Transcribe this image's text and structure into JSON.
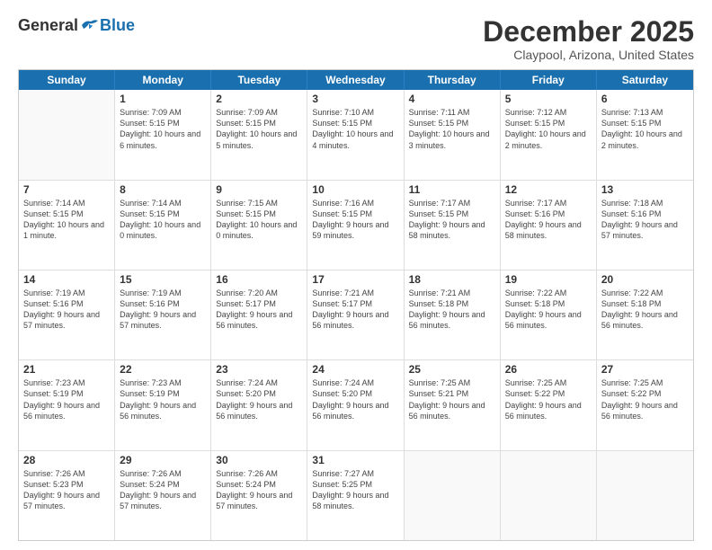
{
  "logo": {
    "general": "General",
    "blue": "Blue"
  },
  "title": "December 2025",
  "location": "Claypool, Arizona, United States",
  "weekdays": [
    "Sunday",
    "Monday",
    "Tuesday",
    "Wednesday",
    "Thursday",
    "Friday",
    "Saturday"
  ],
  "weeks": [
    [
      {
        "day": "",
        "empty": true
      },
      {
        "day": "1",
        "sunrise": "7:09 AM",
        "sunset": "5:15 PM",
        "daylight": "10 hours and 6 minutes."
      },
      {
        "day": "2",
        "sunrise": "7:09 AM",
        "sunset": "5:15 PM",
        "daylight": "10 hours and 5 minutes."
      },
      {
        "day": "3",
        "sunrise": "7:10 AM",
        "sunset": "5:15 PM",
        "daylight": "10 hours and 4 minutes."
      },
      {
        "day": "4",
        "sunrise": "7:11 AM",
        "sunset": "5:15 PM",
        "daylight": "10 hours and 3 minutes."
      },
      {
        "day": "5",
        "sunrise": "7:12 AM",
        "sunset": "5:15 PM",
        "daylight": "10 hours and 2 minutes."
      },
      {
        "day": "6",
        "sunrise": "7:13 AM",
        "sunset": "5:15 PM",
        "daylight": "10 hours and 2 minutes."
      }
    ],
    [
      {
        "day": "7",
        "sunrise": "7:14 AM",
        "sunset": "5:15 PM",
        "daylight": "10 hours and 1 minute."
      },
      {
        "day": "8",
        "sunrise": "7:14 AM",
        "sunset": "5:15 PM",
        "daylight": "10 hours and 0 minutes."
      },
      {
        "day": "9",
        "sunrise": "7:15 AM",
        "sunset": "5:15 PM",
        "daylight": "10 hours and 0 minutes."
      },
      {
        "day": "10",
        "sunrise": "7:16 AM",
        "sunset": "5:15 PM",
        "daylight": "9 hours and 59 minutes."
      },
      {
        "day": "11",
        "sunrise": "7:17 AM",
        "sunset": "5:15 PM",
        "daylight": "9 hours and 58 minutes."
      },
      {
        "day": "12",
        "sunrise": "7:17 AM",
        "sunset": "5:16 PM",
        "daylight": "9 hours and 58 minutes."
      },
      {
        "day": "13",
        "sunrise": "7:18 AM",
        "sunset": "5:16 PM",
        "daylight": "9 hours and 57 minutes."
      }
    ],
    [
      {
        "day": "14",
        "sunrise": "7:19 AM",
        "sunset": "5:16 PM",
        "daylight": "9 hours and 57 minutes."
      },
      {
        "day": "15",
        "sunrise": "7:19 AM",
        "sunset": "5:16 PM",
        "daylight": "9 hours and 57 minutes."
      },
      {
        "day": "16",
        "sunrise": "7:20 AM",
        "sunset": "5:17 PM",
        "daylight": "9 hours and 56 minutes."
      },
      {
        "day": "17",
        "sunrise": "7:21 AM",
        "sunset": "5:17 PM",
        "daylight": "9 hours and 56 minutes."
      },
      {
        "day": "18",
        "sunrise": "7:21 AM",
        "sunset": "5:18 PM",
        "daylight": "9 hours and 56 minutes."
      },
      {
        "day": "19",
        "sunrise": "7:22 AM",
        "sunset": "5:18 PM",
        "daylight": "9 hours and 56 minutes."
      },
      {
        "day": "20",
        "sunrise": "7:22 AM",
        "sunset": "5:18 PM",
        "daylight": "9 hours and 56 minutes."
      }
    ],
    [
      {
        "day": "21",
        "sunrise": "7:23 AM",
        "sunset": "5:19 PM",
        "daylight": "9 hours and 56 minutes."
      },
      {
        "day": "22",
        "sunrise": "7:23 AM",
        "sunset": "5:19 PM",
        "daylight": "9 hours and 56 minutes."
      },
      {
        "day": "23",
        "sunrise": "7:24 AM",
        "sunset": "5:20 PM",
        "daylight": "9 hours and 56 minutes."
      },
      {
        "day": "24",
        "sunrise": "7:24 AM",
        "sunset": "5:20 PM",
        "daylight": "9 hours and 56 minutes."
      },
      {
        "day": "25",
        "sunrise": "7:25 AM",
        "sunset": "5:21 PM",
        "daylight": "9 hours and 56 minutes."
      },
      {
        "day": "26",
        "sunrise": "7:25 AM",
        "sunset": "5:22 PM",
        "daylight": "9 hours and 56 minutes."
      },
      {
        "day": "27",
        "sunrise": "7:25 AM",
        "sunset": "5:22 PM",
        "daylight": "9 hours and 56 minutes."
      }
    ],
    [
      {
        "day": "28",
        "sunrise": "7:26 AM",
        "sunset": "5:23 PM",
        "daylight": "9 hours and 57 minutes."
      },
      {
        "day": "29",
        "sunrise": "7:26 AM",
        "sunset": "5:24 PM",
        "daylight": "9 hours and 57 minutes."
      },
      {
        "day": "30",
        "sunrise": "7:26 AM",
        "sunset": "5:24 PM",
        "daylight": "9 hours and 57 minutes."
      },
      {
        "day": "31",
        "sunrise": "7:27 AM",
        "sunset": "5:25 PM",
        "daylight": "9 hours and 58 minutes."
      },
      {
        "day": "",
        "empty": true
      },
      {
        "day": "",
        "empty": true
      },
      {
        "day": "",
        "empty": true
      }
    ]
  ]
}
